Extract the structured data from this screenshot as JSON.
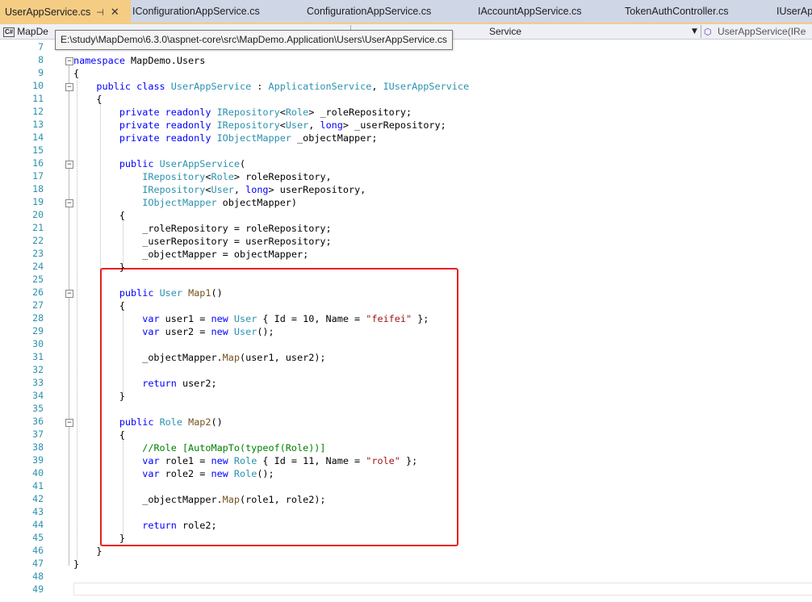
{
  "tabs": [
    {
      "label": "UserAppService.cs",
      "active": true,
      "pin": "⊣",
      "close": "✕"
    },
    {
      "label": "IConfigurationAppService.cs"
    },
    {
      "label": "ConfigurationAppService.cs"
    },
    {
      "label": "IAccountAppService.cs"
    },
    {
      "label": "TokenAuthController.cs"
    },
    {
      "label": "IUserApp"
    }
  ],
  "navbar": {
    "project_badge": "C#",
    "project": "MapDe",
    "class_fragment": "Service",
    "member": "UserAppService(IRe",
    "member_icon": "method-icon"
  },
  "tooltip": "E:\\study\\MapDemo\\6.3.0\\aspnet-core\\src\\MapDemo.Application\\Users\\UserAppService.cs",
  "editor": {
    "line_numbers": [
      "7",
      "8",
      "9",
      "10",
      "11",
      "12",
      "13",
      "14",
      "15",
      "16",
      "17",
      "18",
      "19",
      "20",
      "21",
      "22",
      "23",
      "24",
      "25",
      "26",
      "27",
      "28",
      "29",
      "30",
      "31",
      "32",
      "33",
      "34",
      "35",
      "36",
      "37",
      "38",
      "39",
      "40",
      "41",
      "42",
      "43",
      "44",
      "45",
      "46",
      "47",
      "48",
      "49"
    ],
    "code": [
      [],
      [
        {
          "c": "kw",
          "t": "namespace"
        },
        {
          "t": " MapDemo.Users"
        }
      ],
      [
        {
          "t": "{"
        }
      ],
      [
        {
          "t": "    "
        },
        {
          "c": "kw",
          "t": "public class"
        },
        {
          "t": " "
        },
        {
          "c": "ty",
          "t": "UserAppService"
        },
        {
          "t": " : "
        },
        {
          "c": "ty",
          "t": "ApplicationService"
        },
        {
          "t": ", "
        },
        {
          "c": "ty",
          "t": "IUserAppService"
        }
      ],
      [
        {
          "t": "    {"
        }
      ],
      [
        {
          "t": "        "
        },
        {
          "c": "kw",
          "t": "private readonly"
        },
        {
          "t": " "
        },
        {
          "c": "ty",
          "t": "IRepository"
        },
        {
          "t": "<"
        },
        {
          "c": "ty",
          "t": "Role"
        },
        {
          "t": "> _roleRepository;"
        }
      ],
      [
        {
          "t": "        "
        },
        {
          "c": "kw",
          "t": "private readonly"
        },
        {
          "t": " "
        },
        {
          "c": "ty",
          "t": "IRepository"
        },
        {
          "t": "<"
        },
        {
          "c": "ty",
          "t": "User"
        },
        {
          "t": ", "
        },
        {
          "c": "kw",
          "t": "long"
        },
        {
          "t": "> _userRepository;"
        }
      ],
      [
        {
          "t": "        "
        },
        {
          "c": "kw",
          "t": "private readonly"
        },
        {
          "t": " "
        },
        {
          "c": "ty",
          "t": "IObjectMapper"
        },
        {
          "t": " _objectMapper;"
        }
      ],
      [],
      [
        {
          "t": "        "
        },
        {
          "c": "kw",
          "t": "public"
        },
        {
          "t": " "
        },
        {
          "c": "ty",
          "t": "UserAppService"
        },
        {
          "t": "("
        }
      ],
      [
        {
          "t": "            "
        },
        {
          "c": "ty",
          "t": "IRepository"
        },
        {
          "t": "<"
        },
        {
          "c": "ty",
          "t": "Role"
        },
        {
          "t": "> roleRepository,"
        }
      ],
      [
        {
          "t": "            "
        },
        {
          "c": "ty",
          "t": "IRepository"
        },
        {
          "t": "<"
        },
        {
          "c": "ty",
          "t": "User"
        },
        {
          "t": ", "
        },
        {
          "c": "kw",
          "t": "long"
        },
        {
          "t": "> userRepository,"
        }
      ],
      [
        {
          "t": "            "
        },
        {
          "c": "ty",
          "t": "IObjectMapper"
        },
        {
          "t": " objectMapper)"
        }
      ],
      [
        {
          "t": "        {"
        }
      ],
      [
        {
          "t": "            _roleRepository = roleRepository;"
        }
      ],
      [
        {
          "t": "            _userRepository = userRepository;"
        }
      ],
      [
        {
          "t": "            _objectMapper = objectMapper;"
        }
      ],
      [
        {
          "t": "        }"
        }
      ],
      [],
      [
        {
          "t": "        "
        },
        {
          "c": "kw",
          "t": "public"
        },
        {
          "t": " "
        },
        {
          "c": "ty",
          "t": "User"
        },
        {
          "t": " "
        },
        {
          "c": "mt",
          "t": "Map1"
        },
        {
          "t": "()"
        }
      ],
      [
        {
          "t": "        {"
        }
      ],
      [
        {
          "t": "            "
        },
        {
          "c": "kw",
          "t": "var"
        },
        {
          "t": " user1 = "
        },
        {
          "c": "kw",
          "t": "new"
        },
        {
          "t": " "
        },
        {
          "c": "ty",
          "t": "User"
        },
        {
          "t": " { Id = 10, Name = "
        },
        {
          "c": "str",
          "t": "\"feifei\""
        },
        {
          "t": " };"
        }
      ],
      [
        {
          "t": "            "
        },
        {
          "c": "kw",
          "t": "var"
        },
        {
          "t": " user2 = "
        },
        {
          "c": "kw",
          "t": "new"
        },
        {
          "t": " "
        },
        {
          "c": "ty",
          "t": "User"
        },
        {
          "t": "();"
        }
      ],
      [],
      [
        {
          "t": "            _objectMapper."
        },
        {
          "c": "mt",
          "t": "Map"
        },
        {
          "t": "(user1, user2);"
        }
      ],
      [],
      [
        {
          "t": "            "
        },
        {
          "c": "kw",
          "t": "return"
        },
        {
          "t": " user2;"
        }
      ],
      [
        {
          "t": "        }"
        }
      ],
      [],
      [
        {
          "t": "        "
        },
        {
          "c": "kw",
          "t": "public"
        },
        {
          "t": " "
        },
        {
          "c": "ty",
          "t": "Role"
        },
        {
          "t": " "
        },
        {
          "c": "mt",
          "t": "Map2"
        },
        {
          "t": "()"
        }
      ],
      [
        {
          "t": "        {"
        }
      ],
      [
        {
          "t": "            "
        },
        {
          "c": "cm",
          "t": "//Role [AutoMapTo(typeof(Role))]"
        }
      ],
      [
        {
          "t": "            "
        },
        {
          "c": "kw",
          "t": "var"
        },
        {
          "t": " role1 = "
        },
        {
          "c": "kw",
          "t": "new"
        },
        {
          "t": " "
        },
        {
          "c": "ty",
          "t": "Role"
        },
        {
          "t": " { Id = 11, Name = "
        },
        {
          "c": "str",
          "t": "\"role\""
        },
        {
          "t": " };"
        }
      ],
      [
        {
          "t": "            "
        },
        {
          "c": "kw",
          "t": "var"
        },
        {
          "t": " role2 = "
        },
        {
          "c": "kw",
          "t": "new"
        },
        {
          "t": " "
        },
        {
          "c": "ty",
          "t": "Role"
        },
        {
          "t": "();"
        }
      ],
      [],
      [
        {
          "t": "            _objectMapper."
        },
        {
          "c": "mt",
          "t": "Map"
        },
        {
          "t": "(role1, role2);"
        }
      ],
      [],
      [
        {
          "t": "            "
        },
        {
          "c": "kw",
          "t": "return"
        },
        {
          "t": " role2;"
        }
      ],
      [
        {
          "t": "        }"
        }
      ],
      [
        {
          "t": "    }"
        }
      ],
      [
        {
          "t": "}"
        }
      ],
      [],
      []
    ]
  },
  "colors": {
    "keyword": "#0000ff",
    "type": "#2b91af",
    "string": "#a31515",
    "comment": "#008000",
    "line_number": "#2b91af",
    "active_tab": "#f5cc84",
    "tab_bar": "#cfd6e5",
    "highlight_box": "#e8201f"
  }
}
